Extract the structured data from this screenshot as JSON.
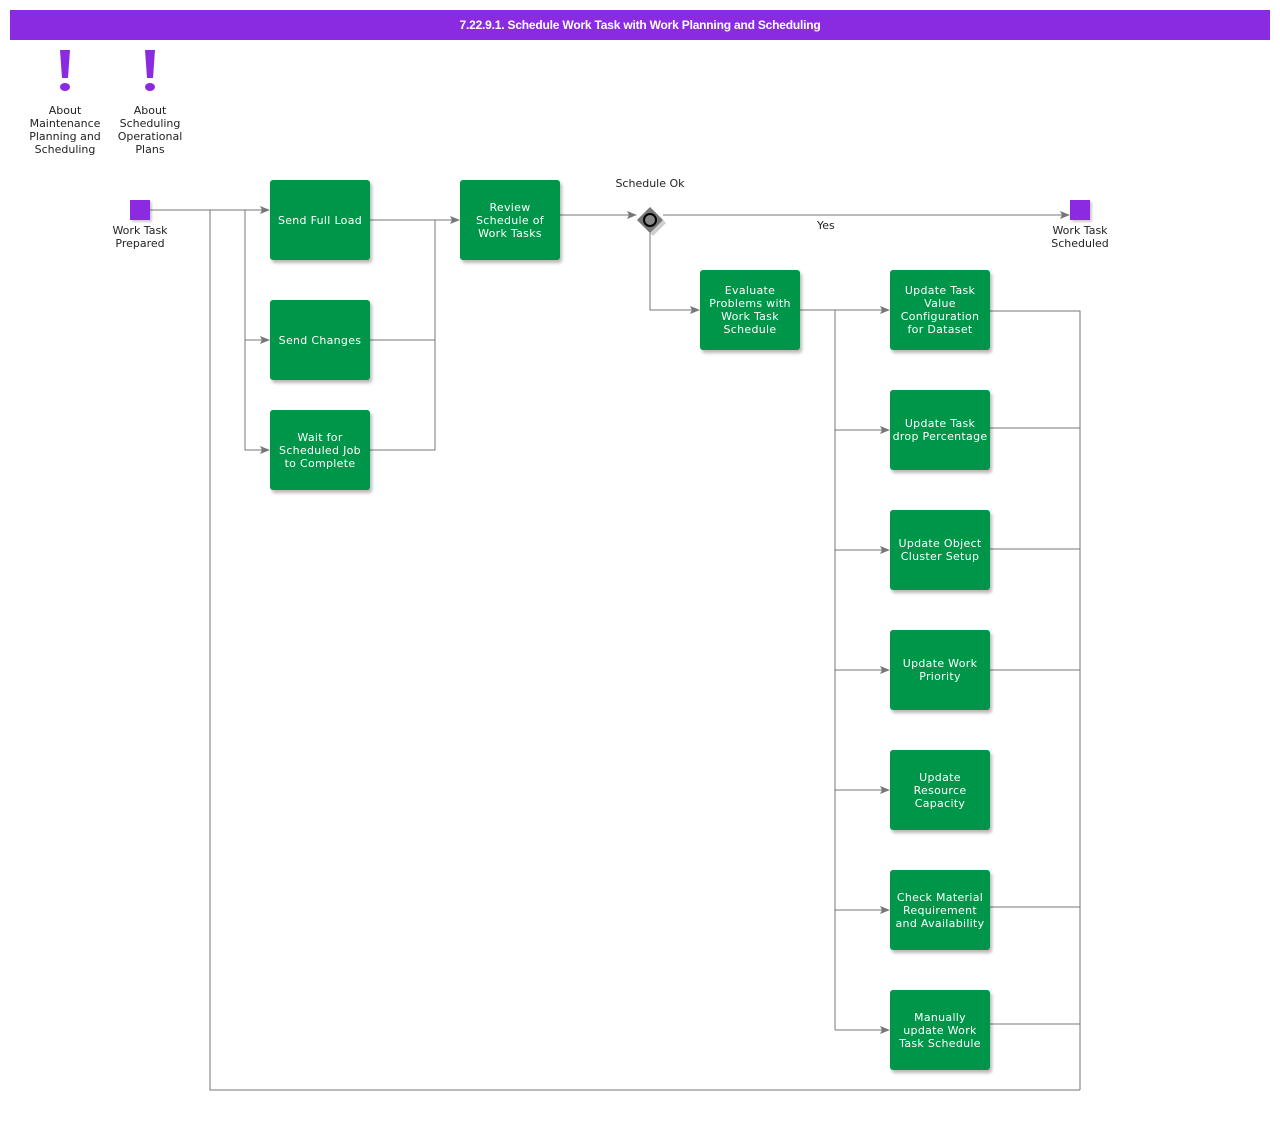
{
  "title": "7.22.9.1. Schedule Work Task with Work Planning and Scheduling",
  "notes": [
    {
      "label": "About Maintenance Planning and Scheduling",
      "icon": "exclamation-icon"
    },
    {
      "label": "About Scheduling Operational Plans",
      "icon": "exclamation-icon"
    }
  ],
  "events": {
    "start": {
      "label": "Work Task Prepared"
    },
    "end": {
      "label": "Work Task Scheduled"
    }
  },
  "gateway": {
    "label": "Schedule Ok",
    "yes_label": "Yes"
  },
  "tasks": {
    "send_full_load": "Send Full Load",
    "send_changes": "Send Changes",
    "wait_for_job": "Wait for Scheduled Job to Complete",
    "review_schedule": "Review Schedule of Work Tasks",
    "evaluate_problems": "Evaluate Problems with Work Task Schedule",
    "update_task_value": "Update Task Value Configuration for Dataset",
    "update_drop_pct": "Update Task drop Percentage",
    "update_object_cluster": "Update Object Cluster Setup",
    "update_work_priority": "Update Work Priority",
    "update_resource_capacity": "Update Resource Capacity",
    "check_material": "Check Material Requirement and Availability",
    "manually_update": "Manually update Work Task Schedule"
  },
  "colors": {
    "header": "#8a2be2",
    "task": "#009649",
    "event": "#8a2be2",
    "connector": "#777777"
  }
}
